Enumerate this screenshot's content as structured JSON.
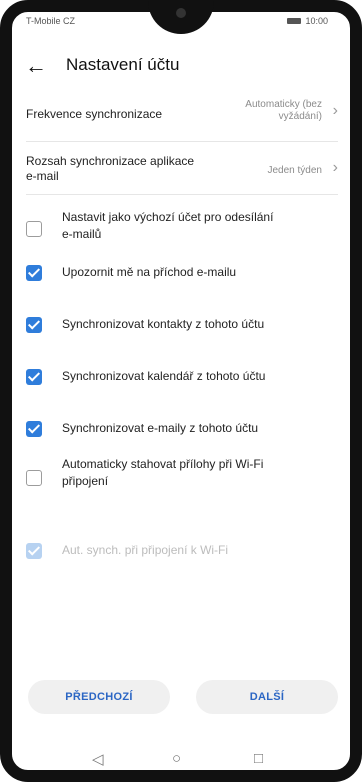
{
  "status": {
    "carrier": "T-Mobile CZ",
    "time": "10:00"
  },
  "header": {
    "title": "Nastavení účtu"
  },
  "rows": [
    {
      "label": "Frekvence synchronizace",
      "value_line1": "Automaticky (bez",
      "value_line2": "vyžádání)"
    },
    {
      "label_line1": "Rozsah synchronizace aplikace",
      "label_line2": "e-mail",
      "value": "Jeden týden"
    }
  ],
  "checks": [
    {
      "line1": "Nastavit jako výchozí účet pro odesílání",
      "line2": "e-mailů",
      "checked": false
    },
    {
      "line1": "Upozornit mě na příchod e-mailu",
      "checked": true
    },
    {
      "line1": "Synchronizovat kontakty z tohoto účtu",
      "checked": true
    },
    {
      "line1": "Synchronizovat kalendář z tohoto účtu",
      "checked": true
    },
    {
      "line1": "Synchronizovat e-maily z tohoto účtu",
      "checked": true
    },
    {
      "line1": "Automaticky stahovat přílohy při Wi-Fi",
      "line2": "připojení",
      "checked": false
    },
    {
      "line1": "Aut. synch. při připojení k Wi-Fi",
      "checked": true,
      "disabled": true
    }
  ],
  "buttons": {
    "prev": "PŘEDCHOZÍ",
    "next": "DALŠÍ"
  },
  "colors": {
    "accent": "#2f7ddb",
    "button_text": "#2b66c4"
  }
}
